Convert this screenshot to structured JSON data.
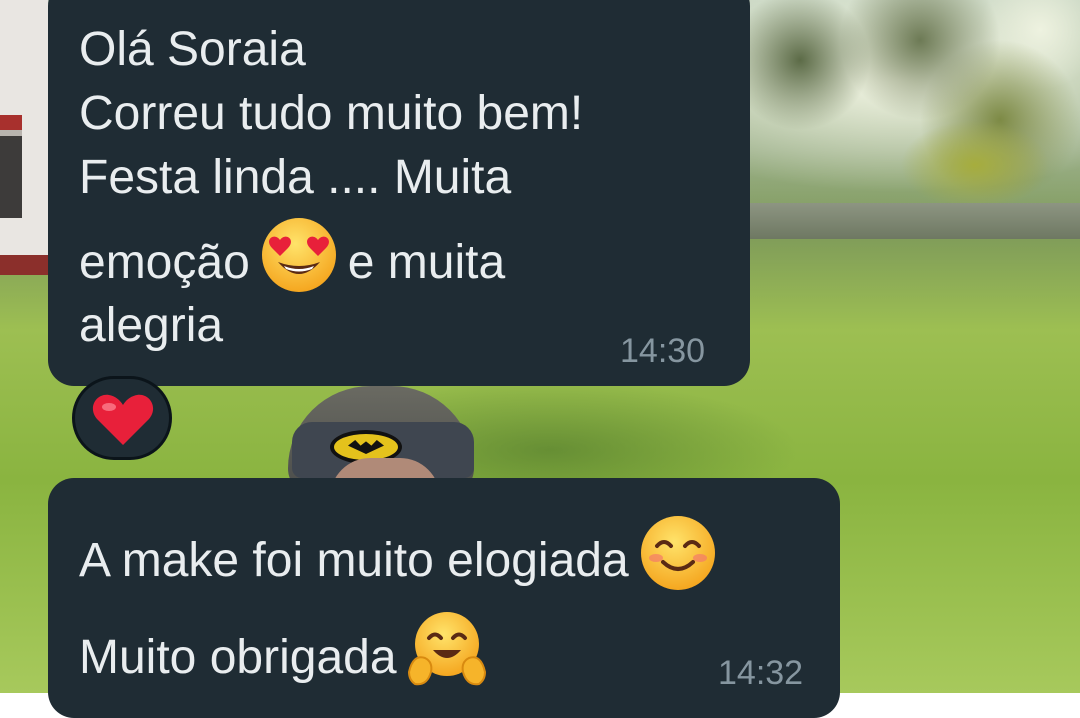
{
  "chat": {
    "messages": [
      {
        "lines": [
          "Olá Soraia",
          "Correu tudo muito bem!",
          "Festa linda .... Muita"
        ],
        "line4_before": "emoção",
        "line4_after": "e muita",
        "line5": "alegria",
        "emoji": "heart-eyes-emoji",
        "time": "14:30",
        "reaction": "red-heart-emoji"
      },
      {
        "line1": "A make foi muito elogiada",
        "line1_emoji": "smiling-face-emoji",
        "line2": "Muito obrigada",
        "line2_emoji": "hugging-face-emoji",
        "time": "14:32"
      }
    ]
  },
  "colors": {
    "bubble": "#1f2c34",
    "text": "#e9edef",
    "timestamp": "#8696a0",
    "heart": "#e8203a"
  }
}
